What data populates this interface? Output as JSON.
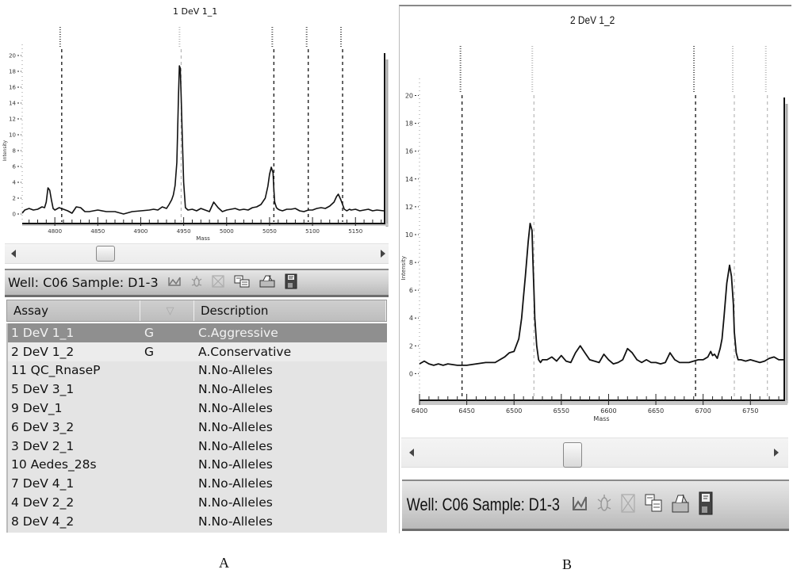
{
  "panelA": {
    "caption": "A",
    "chart_title": "1 DeV 1_1",
    "toolbar": {
      "label": "Well: C06 Sample: D1-3",
      "icons": [
        "peak-edit-icon",
        "bug-icon",
        "close-box-icon",
        "copy-icon",
        "print-icon",
        "save-icon"
      ]
    },
    "table": {
      "headers": [
        "Assay",
        "▽",
        "Description"
      ],
      "rows": [
        {
          "assay": "1 DeV 1_1",
          "call": "G",
          "description": "C.Aggressive",
          "selected": true
        },
        {
          "assay": "2 DeV 1_2",
          "call": "G",
          "description": "A.Conservative"
        },
        {
          "assay": "11 QC_RnaseP",
          "call": "",
          "description": "N.No-Alleles"
        },
        {
          "assay": "5 DeV 3_1",
          "call": "",
          "description": "N.No-Alleles"
        },
        {
          "assay": "9 DeV_1",
          "call": "",
          "description": "N.No-Alleles"
        },
        {
          "assay": "6 DeV 3_2",
          "call": "",
          "description": "N.No-Alleles"
        },
        {
          "assay": "3 DeV 2_1",
          "call": "",
          "description": "N.No-Alleles"
        },
        {
          "assay": "10 Aedes_28s",
          "call": "",
          "description": "N.No-Alleles"
        },
        {
          "assay": "7 DeV 4_1",
          "call": "",
          "description": "N.No-Alleles"
        },
        {
          "assay": "4 DeV 2_2",
          "call": "",
          "description": "N.No-Alleles"
        },
        {
          "assay": "8 DeV 4_2",
          "call": "",
          "description": "N.No-Alleles"
        }
      ]
    },
    "scroll_position": 0.22
  },
  "panelB": {
    "caption": "B",
    "chart_title": "2 DeV 1_2",
    "toolbar": {
      "label": "Well: C06 Sample: D1-3",
      "icons": [
        "peak-edit-icon",
        "bug-icon",
        "close-box-icon",
        "copy-icon",
        "print-icon",
        "save-icon"
      ]
    },
    "scroll_position": 0.42
  },
  "chart_data": [
    {
      "type": "line",
      "title": "1 DeV 1_1",
      "xlabel": "Mass",
      "ylabel": "Intensity",
      "xlim": [
        4762,
        5183
      ],
      "ylim": [
        -1,
        21
      ],
      "xticks": [
        4800,
        4850,
        4900,
        4950,
        5000,
        5050,
        5100,
        5150
      ],
      "yticks": [
        0,
        2,
        4,
        6,
        8,
        10,
        12,
        14,
        16,
        18,
        20
      ],
      "markers": [
        {
          "x": 4808,
          "style": "dark"
        },
        {
          "x": 4947,
          "style": "light"
        },
        {
          "x": 5055,
          "style": "dark"
        },
        {
          "x": 5095,
          "style": "dark"
        },
        {
          "x": 5135,
          "style": "dark"
        }
      ],
      "series": [
        {
          "name": "spectrum",
          "x": [
            4762,
            4765,
            4770,
            4775,
            4780,
            4785,
            4788,
            4790,
            4792,
            4794,
            4796,
            4798,
            4800,
            4805,
            4810,
            4815,
            4820,
            4825,
            4830,
            4835,
            4840,
            4845,
            4850,
            4860,
            4870,
            4880,
            4890,
            4900,
            4910,
            4915,
            4920,
            4925,
            4930,
            4933,
            4936,
            4938,
            4940,
            4942,
            4943,
            4944,
            4945,
            4946,
            4947,
            4948,
            4950,
            4952,
            4955,
            4960,
            4965,
            4970,
            4975,
            4980,
            4985,
            4990,
            4995,
            5000,
            5005,
            5010,
            5015,
            5020,
            5025,
            5030,
            5035,
            5040,
            5045,
            5048,
            5050,
            5052,
            5054,
            5055,
            5056,
            5058,
            5060,
            5062,
            5065,
            5070,
            5075,
            5080,
            5085,
            5090,
            5095,
            5100,
            5105,
            5110,
            5115,
            5120,
            5125,
            5128,
            5130,
            5133,
            5135,
            5137,
            5140,
            5143,
            5145,
            5150,
            5155,
            5160,
            5165,
            5170,
            5175,
            5183
          ],
          "y": [
            0.1,
            0.5,
            0.7,
            0.5,
            0.6,
            0.9,
            0.8,
            1.5,
            3.3,
            3.0,
            1.8,
            0.7,
            0.5,
            0.8,
            0.6,
            0.4,
            0.1,
            0.9,
            0.8,
            0.3,
            0.3,
            0.4,
            0.5,
            0.3,
            0.3,
            0.0,
            0.3,
            0.4,
            0.5,
            0.6,
            0.5,
            0.9,
            0.7,
            1.2,
            1.8,
            2.4,
            3.6,
            6.5,
            10.5,
            15.0,
            18.7,
            18.4,
            15.0,
            11.0,
            4.0,
            0.8,
            0.5,
            0.6,
            0.4,
            0.7,
            0.5,
            0.3,
            1.5,
            0.8,
            0.3,
            0.5,
            0.6,
            0.7,
            0.5,
            0.6,
            0.5,
            0.8,
            0.9,
            1.2,
            2.0,
            3.5,
            5.0,
            5.9,
            5.2,
            3.0,
            1.5,
            0.8,
            0.6,
            0.5,
            0.4,
            0.6,
            0.6,
            0.7,
            0.4,
            0.3,
            0.5,
            0.5,
            0.7,
            0.8,
            0.7,
            1.0,
            1.5,
            2.2,
            2.5,
            1.8,
            1.2,
            0.6,
            0.4,
            0.6,
            0.5,
            0.6,
            0.4,
            0.5,
            0.6,
            0.4,
            0.5,
            0.4
          ]
        }
      ]
    },
    {
      "type": "line",
      "title": "2 DeV 1_2",
      "xlabel": "Mass",
      "ylabel": "Intensity",
      "xlim": [
        6400,
        6785
      ],
      "ylim": [
        -1.8,
        21
      ],
      "xticks": [
        6400,
        6450,
        6500,
        6550,
        6600,
        6650,
        6700,
        6750
      ],
      "yticks": [
        0,
        2,
        4,
        6,
        8,
        10,
        12,
        14,
        16,
        18,
        20
      ],
      "markers": [
        {
          "x": 6445,
          "style": "dark"
        },
        {
          "x": 6521,
          "style": "light"
        },
        {
          "x": 6692,
          "style": "dark"
        },
        {
          "x": 6733,
          "style": "light"
        },
        {
          "x": 6768,
          "style": "light"
        }
      ],
      "series": [
        {
          "name": "spectrum",
          "x": [
            6400,
            6405,
            6410,
            6415,
            6420,
            6425,
            6430,
            6440,
            6450,
            6460,
            6470,
            6480,
            6485,
            6490,
            6495,
            6500,
            6505,
            6508,
            6510,
            6512,
            6515,
            6517,
            6519,
            6520,
            6521,
            6522,
            6524,
            6526,
            6528,
            6530,
            6535,
            6540,
            6545,
            6550,
            6555,
            6560,
            6565,
            6570,
            6575,
            6580,
            6585,
            6590,
            6595,
            6600,
            6605,
            6610,
            6615,
            6620,
            6625,
            6630,
            6635,
            6640,
            6645,
            6650,
            6655,
            6660,
            6665,
            6670,
            6675,
            6680,
            6685,
            6690,
            6695,
            6700,
            6705,
            6708,
            6710,
            6712,
            6715,
            6718,
            6720,
            6722,
            6725,
            6728,
            6730,
            6732,
            6733,
            6735,
            6737,
            6740,
            6745,
            6750,
            6755,
            6760,
            6765,
            6770,
            6775,
            6780,
            6785
          ],
          "y": [
            0.7,
            0.9,
            0.7,
            0.6,
            0.7,
            0.6,
            0.7,
            0.6,
            0.6,
            0.7,
            0.8,
            0.8,
            1.0,
            1.2,
            1.5,
            1.6,
            2.5,
            4.0,
            5.5,
            7.0,
            9.5,
            10.8,
            10.3,
            8.0,
            6.0,
            4.0,
            2.0,
            1.0,
            0.8,
            1.0,
            1.0,
            1.2,
            0.9,
            1.3,
            0.9,
            0.8,
            1.5,
            2.0,
            1.5,
            1.0,
            0.9,
            0.8,
            1.4,
            1.0,
            0.7,
            0.8,
            1.0,
            1.8,
            1.5,
            1.0,
            0.8,
            1.0,
            0.8,
            0.8,
            0.7,
            0.8,
            1.5,
            1.0,
            0.8,
            0.8,
            0.8,
            0.9,
            1.0,
            1.0,
            1.2,
            1.6,
            1.3,
            1.4,
            1.1,
            1.8,
            2.5,
            4.0,
            6.5,
            7.8,
            7.0,
            5.0,
            3.0,
            1.5,
            1.0,
            1.0,
            0.9,
            1.0,
            0.9,
            0.8,
            0.9,
            1.1,
            1.2,
            1.0,
            1.0
          ]
        }
      ]
    }
  ]
}
